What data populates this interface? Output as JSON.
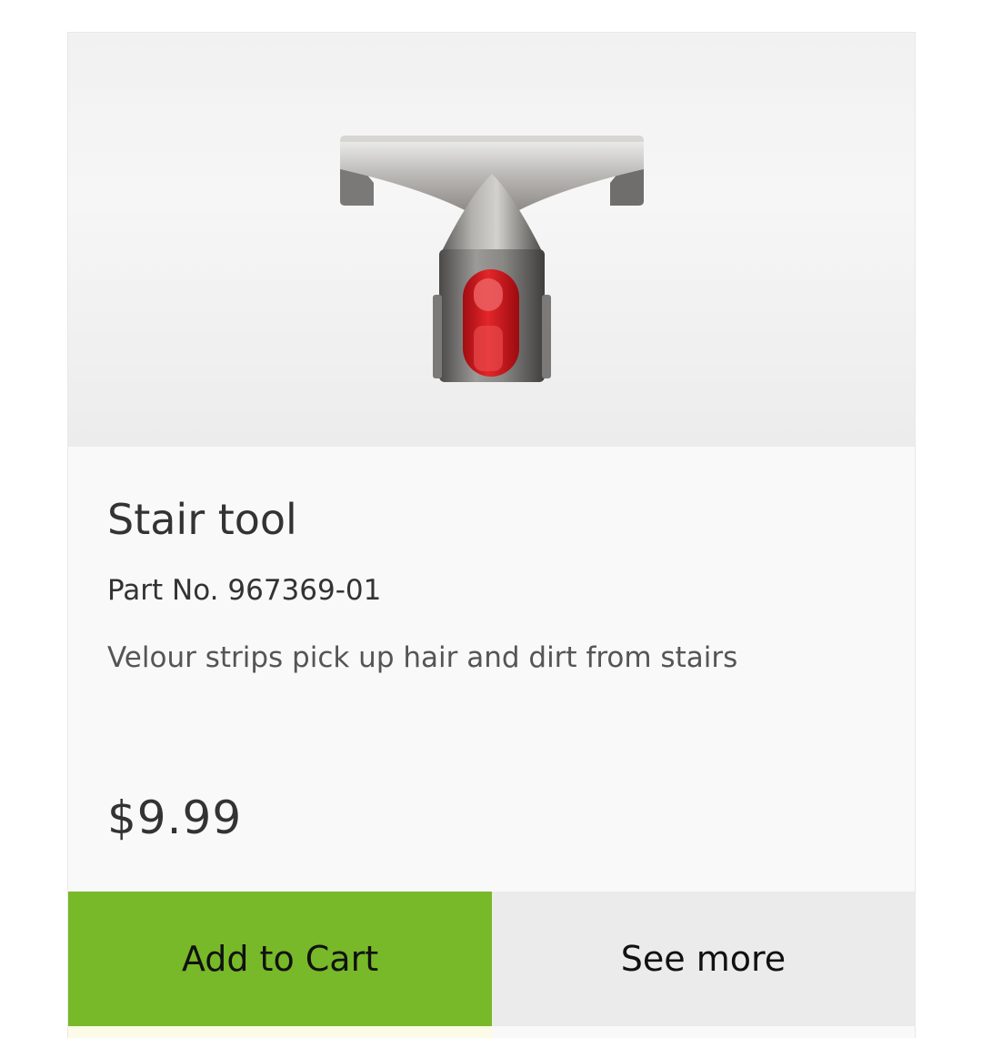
{
  "product": {
    "title": "Stair tool",
    "part_number": "Part No. 967369-01",
    "description": "Velour strips pick up hair and dirt from stairs",
    "price": "$9.99",
    "image_icon": "stair-tool-product-image"
  },
  "actions": {
    "add_to_cart_label": "Add to Cart",
    "see_more_label": "See more"
  },
  "colors": {
    "accent": "#77b928",
    "secondary_button": "#ebebeb",
    "product_red": "#d9141b"
  }
}
